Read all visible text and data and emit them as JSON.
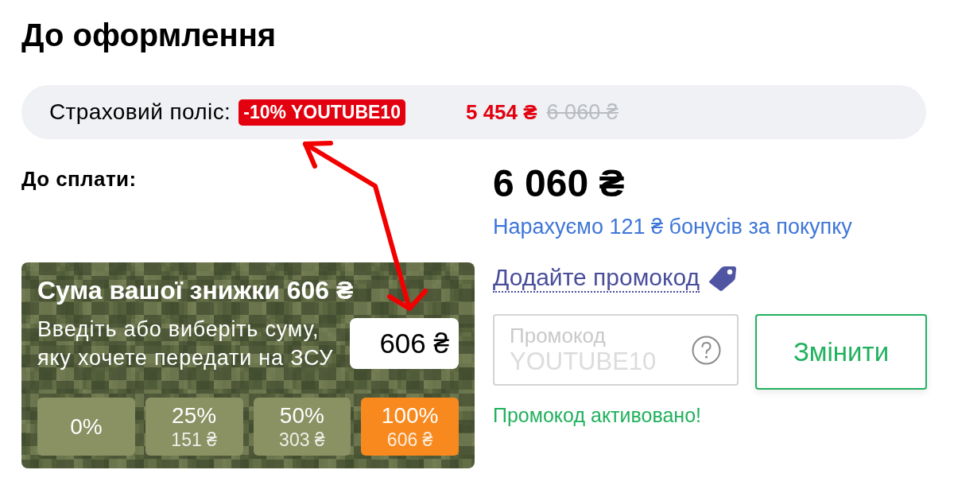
{
  "page_title": "До оформлення",
  "insurance": {
    "label": "Страховий поліс:",
    "promo_badge": "-10% YOUTUBE10",
    "price": "5 454 ₴",
    "old_price": "6 060 ₴"
  },
  "payment": {
    "label": "До сплати:",
    "total": "6 060 ₴",
    "bonus_note": "Нарахуємо 121 ₴ бонусів за покупку"
  },
  "donation": {
    "title": "Сума вашої знижки 606 ₴",
    "prompt": "Введіть або виберіть суму, яку хочете передати на ЗСУ",
    "amount_value": "606 ₴",
    "options": [
      {
        "label": "0%",
        "selected": false
      },
      {
        "label": "25%",
        "amount": "151 ₴",
        "selected": false
      },
      {
        "label": "50%",
        "amount": "303 ₴",
        "selected": false
      },
      {
        "label": "100%",
        "amount": "606 ₴",
        "selected": true
      }
    ]
  },
  "promo": {
    "link": "Додайте промокод",
    "field": {
      "label": "Промокод",
      "value": "YOUTUBE10",
      "disabled": true
    },
    "button": "Змінити",
    "status": "Промокод активовано!"
  }
}
